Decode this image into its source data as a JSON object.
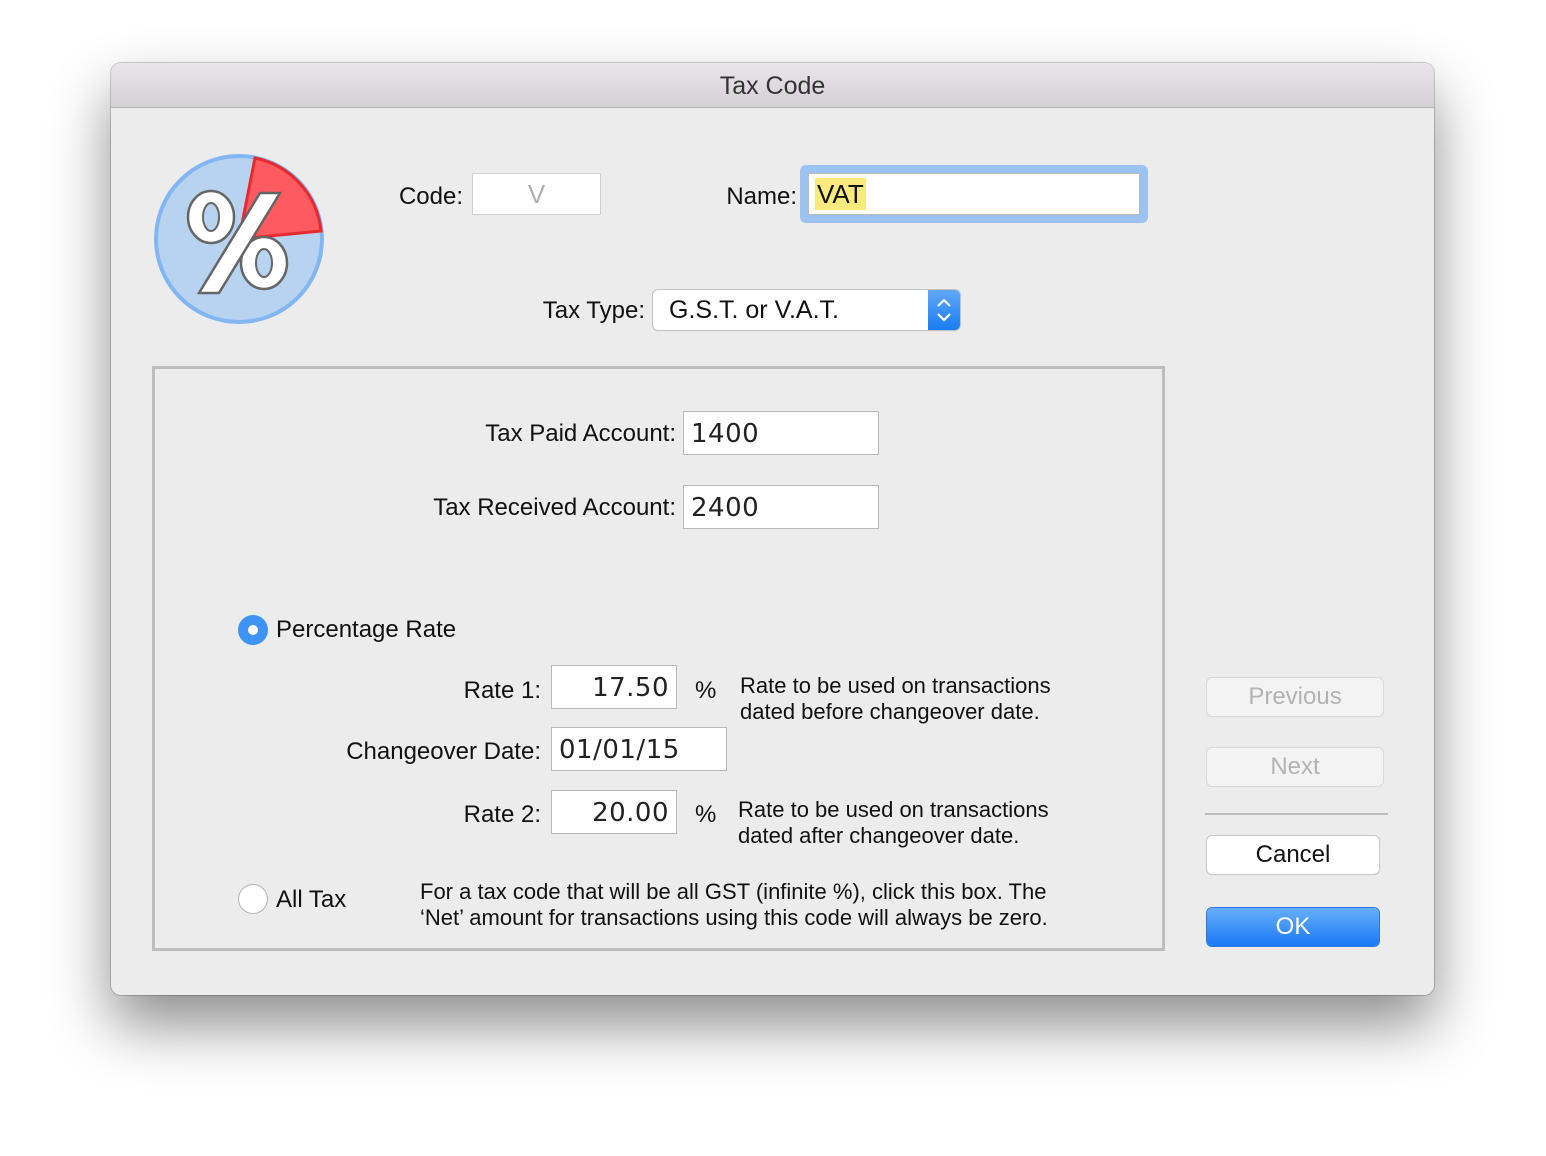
{
  "window": {
    "title": "Tax Code"
  },
  "header": {
    "icon": "percent-pie-icon",
    "code_label": "Code:",
    "code_value": "V",
    "name_label": "Name:",
    "name_value": "VAT",
    "tax_type_label": "Tax Type:",
    "tax_type_value": "G.S.T. or V.A.T."
  },
  "accounts": {
    "tax_paid_label": "Tax Paid Account:",
    "tax_paid_value": "1400",
    "tax_received_label": "Tax Received Account:",
    "tax_received_value": "2400"
  },
  "percentage": {
    "radio_label": "Percentage Rate",
    "selected": true,
    "rate1_label": "Rate 1:",
    "rate1_value": "17.50",
    "rate1_unit": "%",
    "rate1_desc_line1": "Rate to be used on transactions",
    "rate1_desc_line2": "dated before changeover date.",
    "changeover_label": "Changeover Date:",
    "changeover_value": "01/01/15",
    "rate2_label": "Rate 2:",
    "rate2_value": "20.00",
    "rate2_unit": "%",
    "rate2_desc_line1": "Rate to be used on transactions",
    "rate2_desc_line2": "dated after changeover date."
  },
  "all_tax": {
    "radio_label": "All Tax",
    "selected": false,
    "desc_line1": "For a tax code that will be all GST (infinite %), click this box. The",
    "desc_line2": "‘Net’ amount for transactions using this code will always be zero."
  },
  "buttons": {
    "previous": "Previous",
    "next": "Next",
    "cancel": "Cancel",
    "ok": "OK"
  },
  "colors": {
    "accent": "#1a79f6",
    "selection_highlight": "#f8ea7c",
    "focus_ring": "#9cc3f0"
  }
}
